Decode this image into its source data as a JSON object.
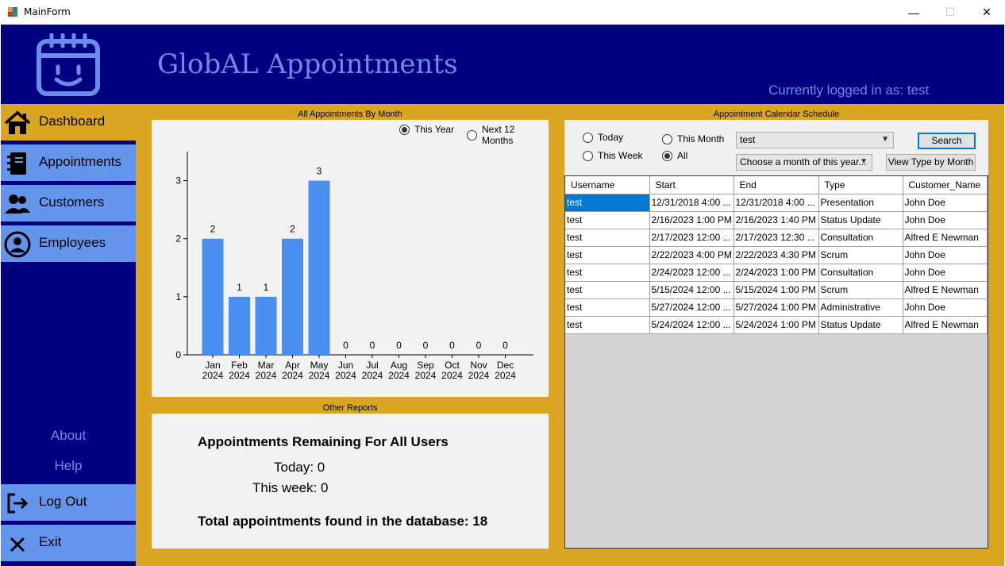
{
  "window": {
    "title": "MainForm",
    "minimize": "—",
    "maximize": "☐",
    "close": "✕"
  },
  "header": {
    "app_title": "GlobAL Appointments",
    "logged_in": "Currently logged in as: test"
  },
  "sidebar": {
    "items": [
      {
        "label": "Dashboard",
        "icon": "home-icon"
      },
      {
        "label": "Appointments",
        "icon": "notebook-icon"
      },
      {
        "label": "Customers",
        "icon": "users-icon"
      },
      {
        "label": "Employees",
        "icon": "user-circle-icon"
      }
    ],
    "about": "About",
    "help": "Help",
    "logout": "Log Out",
    "exit": "Exit"
  },
  "chart_panel": {
    "caption": "All Appointments By Month",
    "radio_this_year": "This Year",
    "radio_next_12": "Next 12 Months",
    "selected": "This Year"
  },
  "chart_data": {
    "type": "bar",
    "categories": [
      "Jan\n2024",
      "Feb\n2024",
      "Mar\n2024",
      "Apr\n2024",
      "May\n2024",
      "Jun\n2024",
      "Jul\n2024",
      "Aug\n2024",
      "Sep\n2024",
      "Oct\n2024",
      "Nov\n2024",
      "Dec\n2024"
    ],
    "values": [
      2,
      1,
      1,
      2,
      3,
      0,
      0,
      0,
      0,
      0,
      0,
      0
    ],
    "yticks": [
      0,
      1,
      2,
      3
    ],
    "ylim": [
      0,
      3.5
    ],
    "bar_color": "#4a8fed"
  },
  "reports": {
    "caption": "Other Reports",
    "heading": "Appointments Remaining For All Users",
    "today": "Today: 0",
    "this_week": "This week: 0",
    "total": "Total appointments found in the database: 18"
  },
  "schedule": {
    "caption": "Appointment Calendar Schedule",
    "radio_today": "Today",
    "radio_this_week": "This Week",
    "radio_this_month": "This Month",
    "radio_all": "All",
    "selected": "All",
    "user_combo": "test",
    "month_combo": "Choose a month of this year...",
    "search_button": "Search",
    "view_type_button": "View Type by Month",
    "columns": [
      "Username",
      "Start",
      "End",
      "Type",
      "Customer_Name"
    ],
    "rows": [
      [
        "test",
        "12/31/2018 4:00 ...",
        "12/31/2018 4:00 ...",
        "Presentation",
        "John Doe"
      ],
      [
        "test",
        "2/16/2023 1:00 PM",
        "2/16/2023 1:40 PM",
        "Status Update",
        "John Doe"
      ],
      [
        "test",
        "2/17/2023 12:00 ...",
        "2/17/2023 12:30 ...",
        "Consultation",
        "Alfred E Newman"
      ],
      [
        "test",
        "2/22/2023 4:00 PM",
        "2/22/2023 4:30 PM",
        "Scrum",
        "John Doe"
      ],
      [
        "test",
        "2/24/2023 12:00 ...",
        "2/24/2023 1:00 PM",
        "Consultation",
        "John Doe"
      ],
      [
        "test",
        "5/15/2024 12:00 ...",
        "5/15/2024 1:00 PM",
        "Scrum",
        "Alfred E Newman"
      ],
      [
        "test",
        "5/27/2024 12:00 ...",
        "5/27/2024 1:00 PM",
        "Administrative",
        "John Doe"
      ],
      [
        "test",
        "5/24/2024 12:00 ...",
        "5/24/2024 1:00 PM",
        "Status Update",
        "Alfred E Newman"
      ]
    ]
  },
  "colors": {
    "navy": "#000080",
    "accent_blue": "#6495ed",
    "gold": "#daa520",
    "title_text": "#6b8be8",
    "selection": "#0078d7"
  }
}
